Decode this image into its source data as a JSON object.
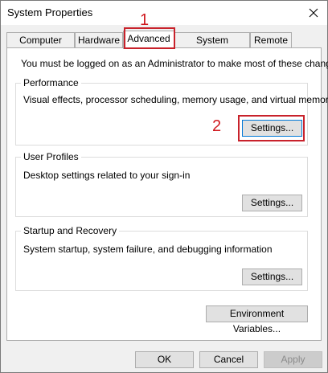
{
  "window": {
    "title": "System Properties"
  },
  "annotations": {
    "step1": "1",
    "step2": "2"
  },
  "tabs": [
    {
      "label": "Computer Name",
      "active": false
    },
    {
      "label": "Hardware",
      "active": false
    },
    {
      "label": "Advanced",
      "active": true
    },
    {
      "label": "System Protection",
      "active": false
    },
    {
      "label": "Remote",
      "active": false
    }
  ],
  "advanced": {
    "intro": "You must be logged on as an Administrator to make most of these changes.",
    "performance": {
      "title": "Performance",
      "description": "Visual effects, processor scheduling, memory usage, and virtual memory",
      "button": "Settings..."
    },
    "user_profiles": {
      "title": "User Profiles",
      "description": "Desktop settings related to your sign-in",
      "button": "Settings..."
    },
    "startup_recovery": {
      "title": "Startup and Recovery",
      "description": "System startup, system failure, and debugging information",
      "button": "Settings..."
    },
    "env_button": "Environment Variables..."
  },
  "footer": {
    "ok": "OK",
    "cancel": "Cancel",
    "apply": "Apply"
  },
  "colors": {
    "annotation": "#c8222b",
    "focus": "#0078d7"
  }
}
